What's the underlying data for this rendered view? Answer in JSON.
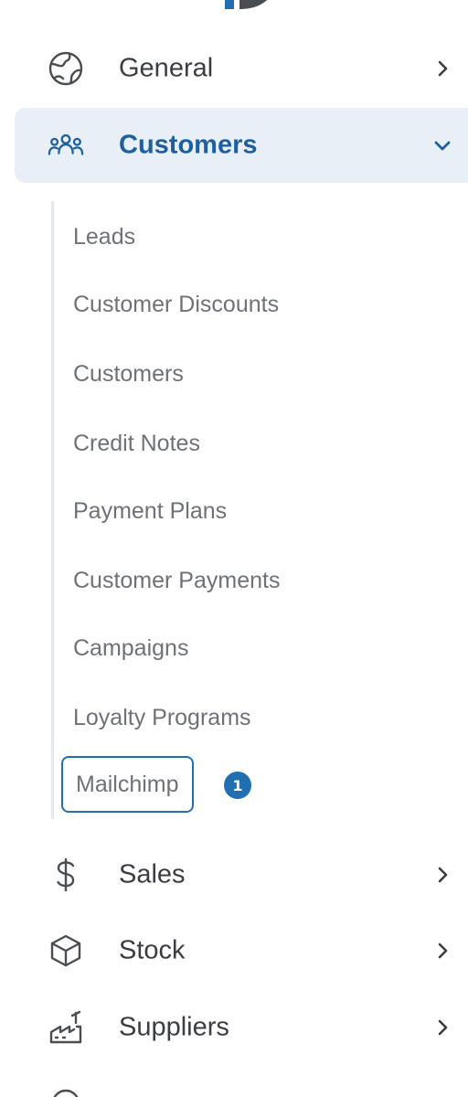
{
  "nav": {
    "general": {
      "label": "General",
      "icon": "globe-icon"
    },
    "customers": {
      "label": "Customers",
      "icon": "users-icon",
      "expanded": true,
      "children": [
        {
          "label": "Leads"
        },
        {
          "label": "Customer Discounts"
        },
        {
          "label": "Customers"
        },
        {
          "label": "Credit Notes"
        },
        {
          "label": "Payment Plans"
        },
        {
          "label": "Customer Payments"
        },
        {
          "label": "Campaigns"
        },
        {
          "label": "Loyalty Programs"
        },
        {
          "label": "Mailchimp",
          "badge": "1",
          "focused": true
        }
      ]
    },
    "sales": {
      "label": "Sales",
      "icon": "dollar-icon"
    },
    "stock": {
      "label": "Stock",
      "icon": "box-icon"
    },
    "suppliers": {
      "label": "Suppliers",
      "icon": "factory-icon"
    }
  },
  "colors": {
    "accent": "#1f6fb2",
    "active_bg": "#e8eff7",
    "active_text": "#1f5fa0",
    "text": "#3a3d42",
    "muted_text": "#6e7278"
  }
}
